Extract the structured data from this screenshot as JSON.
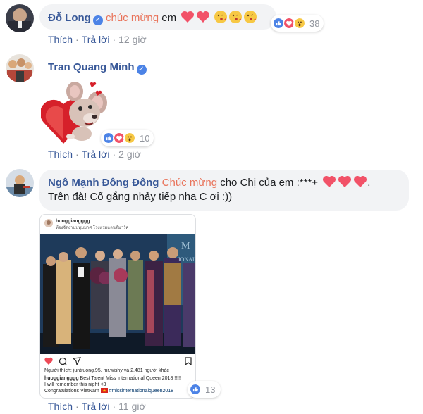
{
  "comments": [
    {
      "author": "Đỗ Long",
      "tag": "chúc mừng",
      "text": " em",
      "actions": {
        "like": "Thích",
        "reply": "Trả lời",
        "time": "12 giờ"
      },
      "reaction_count": "38"
    },
    {
      "author": "Tran Quang Minh",
      "actions": {
        "like": "Thích",
        "reply": "Trả lời",
        "time": "2 giờ"
      },
      "reaction_count": "10"
    },
    {
      "author": "Ngô Mạnh Đông Đông",
      "tag": "Chúc mừng",
      "text": " cho Chị của em :***+ ",
      "text_line2": "Trên đà! Cố gắng nhảy tiếp nha C ơi :))",
      "actions": {
        "like": "Thích",
        "reply": "Trả lời",
        "time": "11 giờ"
      },
      "reaction_count": "13",
      "instagram": {
        "username": "huoggiangggg",
        "location": "ห้องจัดงานปทุมมาศ โรงแรมแลนด์มาร์ค",
        "likes_line": "Người thích: juntruong.95, mr.wishy và 2.481 người khác",
        "caption_user": "huoggiangggg",
        "caption_text": " Best Talent Miss International Queen 2018 !!!!!",
        "caption_line2": "I will remember this night <3",
        "caption_line3": "Congratulations VietNam",
        "hashtag": " #missinternationalqueen2018"
      }
    }
  ],
  "colors": {
    "author": "#385898",
    "tag": "#e9735a",
    "bubble": "#f2f3f5",
    "like_blue": "#4c83e6",
    "heart": "#f25268",
    "muted": "#90949c"
  },
  "icons": [
    "verified-badge-icon",
    "heart-icon",
    "kiss-emoji-icon",
    "like-reaction-icon",
    "love-reaction-icon",
    "wow-reaction-icon",
    "instagram-heart-icon",
    "instagram-comment-icon",
    "instagram-share-icon",
    "instagram-bookmark-icon"
  ]
}
